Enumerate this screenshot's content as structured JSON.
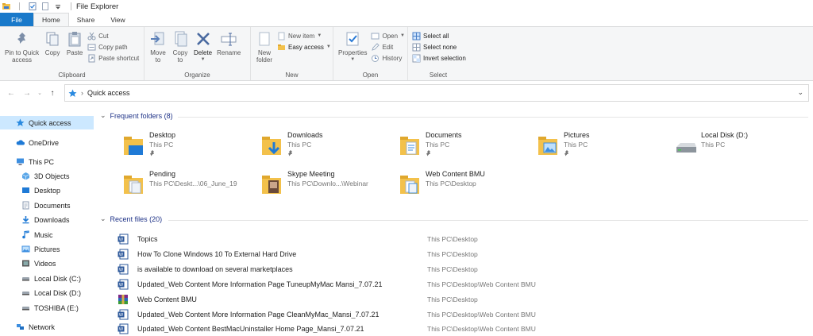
{
  "window": {
    "title": "File Explorer"
  },
  "tabs": [
    {
      "label": "File"
    },
    {
      "label": "Home"
    },
    {
      "label": "Share"
    },
    {
      "label": "View"
    }
  ],
  "ribbon": {
    "clipboard": {
      "label": "Clipboard",
      "pin": [
        "Pin to Quick",
        "access"
      ],
      "copy": "Copy",
      "paste": "Paste",
      "cut": "Cut",
      "copy_path": "Copy path",
      "paste_shortcut": "Paste shortcut"
    },
    "organize": {
      "label": "Organize",
      "move_to": [
        "Move",
        "to"
      ],
      "copy_to": [
        "Copy",
        "to"
      ],
      "delete": "Delete",
      "rename": "Rename"
    },
    "new": {
      "label": "New",
      "new_folder": [
        "New",
        "folder"
      ],
      "new_item": "New item",
      "easy_access": "Easy access"
    },
    "open": {
      "label": "Open",
      "properties": "Properties",
      "open": "Open",
      "edit": "Edit",
      "history": "History"
    },
    "select": {
      "label": "Select",
      "select_all": "Select all",
      "select_none": "Select none",
      "invert": "Invert selection"
    }
  },
  "address": {
    "crumb": "Quick access"
  },
  "nav_pane": [
    {
      "label": "Quick access",
      "icon": "star-icon",
      "selected": true
    },
    {
      "label": "OneDrive",
      "icon": "cloud-icon"
    },
    {
      "label": "This PC",
      "icon": "computer-icon"
    },
    {
      "label": "3D Objects",
      "icon": "cube-icon"
    },
    {
      "label": "Desktop",
      "icon": "desktop-icon"
    },
    {
      "label": "Documents",
      "icon": "document-icon"
    },
    {
      "label": "Downloads",
      "icon": "download-icon"
    },
    {
      "label": "Music",
      "icon": "music-icon"
    },
    {
      "label": "Pictures",
      "icon": "picture-icon"
    },
    {
      "label": "Videos",
      "icon": "video-icon"
    },
    {
      "label": "Local Disk (C:)",
      "icon": "drive-icon"
    },
    {
      "label": "Local Disk (D:)",
      "icon": "drive-icon"
    },
    {
      "label": "TOSHIBA (E:)",
      "icon": "drive-icon"
    },
    {
      "label": "Network",
      "icon": "network-icon"
    }
  ],
  "frequent": {
    "header": "Frequent folders (8)",
    "items": [
      {
        "name": "Desktop",
        "path": "This PC"
      },
      {
        "name": "Downloads",
        "path": "This PC"
      },
      {
        "name": "Documents",
        "path": "This PC"
      },
      {
        "name": "Pictures",
        "path": "This PC"
      },
      {
        "name": "Local Disk (D:)",
        "path": "This PC"
      },
      {
        "name": "Pending",
        "path": "This PC\\Deskt...\\06_June_19"
      },
      {
        "name": "Skype Meeting",
        "path": "This PC\\Downlo...\\Webinar"
      },
      {
        "name": "Web Content BMU",
        "path": "This PC\\Desktop"
      }
    ]
  },
  "recent": {
    "header": "Recent files (20)",
    "items": [
      {
        "name": "Topics",
        "location": "This PC\\Desktop",
        "icon": "word-doc-icon"
      },
      {
        "name": "How To Clone Windows 10 To External Hard Drive",
        "location": "This PC\\Desktop",
        "icon": "word-doc-icon"
      },
      {
        "name": "is available to download on several marketplaces",
        "location": "This PC\\Desktop",
        "icon": "word-doc-icon"
      },
      {
        "name": "Updated_Web Content More Information Page TuneupMyMac Mansi_7.07.21",
        "location": "This PC\\Desktop\\Web Content BMU",
        "icon": "word-doc-icon"
      },
      {
        "name": "Web Content BMU",
        "location": "This PC\\Desktop",
        "icon": "archive-icon"
      },
      {
        "name": "Updated_Web Content More Information Page CleanMyMac_Mansi_7.07.21",
        "location": "This PC\\Desktop\\Web Content BMU",
        "icon": "word-doc-icon"
      },
      {
        "name": "Updated_Web Content BestMacUninstaller Home Page_Mansi_7.07.21",
        "location": "This PC\\Desktop\\Web Content BMU",
        "icon": "word-doc-icon"
      }
    ]
  }
}
